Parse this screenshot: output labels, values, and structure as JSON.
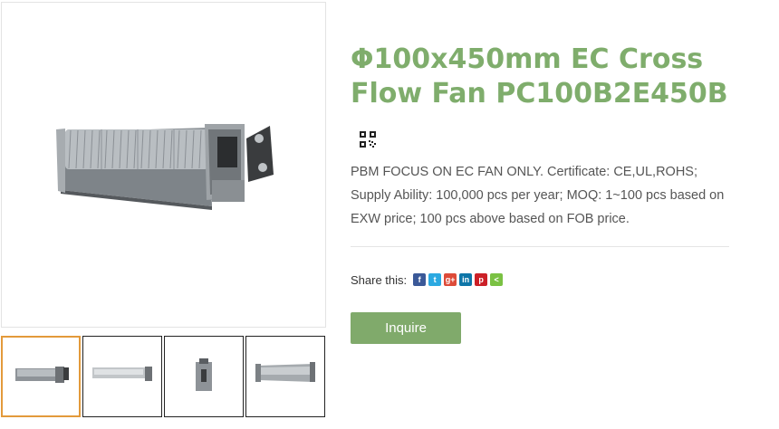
{
  "product": {
    "title": "Φ100x450mm EC Cross Flow Fan PC100B2E450B",
    "description": "PBM FOCUS ON EC FAN ONLY. Certificate: CE,UL,ROHS; Supply Ability: 100,000 pcs per year; MOQ: 1~100 pcs based on EXW price; 100 pcs above based on FOB price.",
    "main_image_icon": "cross-flow-fan-image",
    "qr_icon": "qr-code-icon"
  },
  "share": {
    "label": "Share this:",
    "icons": [
      {
        "name": "facebook-icon",
        "glyph": "f",
        "color": "#3b5998"
      },
      {
        "name": "twitter-icon",
        "glyph": "t",
        "color": "#2ba9e1"
      },
      {
        "name": "google-plus-icon",
        "glyph": "g+",
        "color": "#dd4b39"
      },
      {
        "name": "linkedin-icon",
        "glyph": "in",
        "color": "#0e76a8"
      },
      {
        "name": "pinterest-icon",
        "glyph": "p",
        "color": "#cb2027"
      },
      {
        "name": "share-icon",
        "glyph": "<",
        "color": "#7ac143"
      }
    ]
  },
  "inquire_label": "Inquire",
  "thumbnails": [
    {
      "name": "thumbnail-1",
      "active": true
    },
    {
      "name": "thumbnail-2",
      "active": false
    },
    {
      "name": "thumbnail-3",
      "active": false
    },
    {
      "name": "thumbnail-4",
      "active": false
    }
  ],
  "colors": {
    "title": "#7fad6c",
    "button": "#80aa6b",
    "active_thumb_border": "#e39a3b"
  }
}
